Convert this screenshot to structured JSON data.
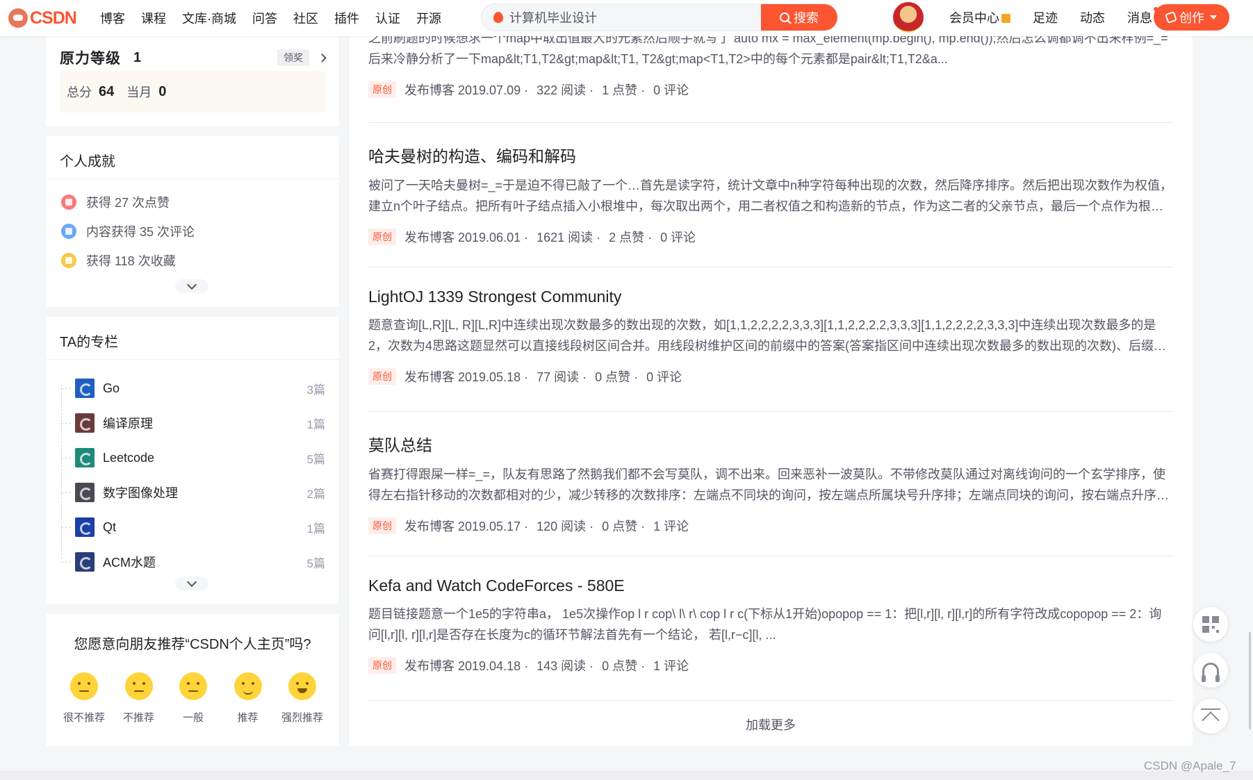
{
  "header": {
    "logo": "CSDN",
    "nav": [
      "博客",
      "课程",
      "文库·商城",
      "问答",
      "社区",
      "插件",
      "认证",
      "开源"
    ],
    "search_value": "计算机毕业设计",
    "search_button": "搜索",
    "right_nav": [
      "会员中心",
      "足迹",
      "动态",
      "消息"
    ],
    "create_button": "创作",
    "accent_color": "#fc5531"
  },
  "level": {
    "name": "原力等级",
    "value": "1",
    "award_button": "领奖",
    "total_label": "总分",
    "total_value": "64",
    "month_label": "当月",
    "month_value": "0"
  },
  "achievements": {
    "title": "个人成就",
    "items": [
      "获得 27 次点赞",
      "内容获得 35 次评论",
      "获得 118 次收藏"
    ]
  },
  "columns": {
    "title": "TA的专栏",
    "items": [
      {
        "name": "Go",
        "count": "3篇",
        "color": "#1f5fbf"
      },
      {
        "name": "编译原理",
        "count": "1篇",
        "color": "#6b3b3b"
      },
      {
        "name": "Leetcode",
        "count": "5篇",
        "color": "#1f8a7a"
      },
      {
        "name": "数字图像处理",
        "count": "2篇",
        "color": "#4a4a55"
      },
      {
        "name": "Qt",
        "count": "1篇",
        "color": "#1a3fa8"
      },
      {
        "name": "ACM水题",
        "count": "5篇",
        "color": "#2a3f7a"
      }
    ]
  },
  "recommend": {
    "title": "您愿意向朋友推荐“CSDN个人主页”吗?",
    "options": [
      "很不推荐",
      "不推荐",
      "一般",
      "推荐",
      "强烈推荐"
    ]
  },
  "articles": [
    {
      "title": "",
      "desc": "之前刷题的时候想求一个map中取出值最大的元素然后顺手就写了 auto mx = max_element(mp.begin(), mp.end());然后怎么调都调不出来样例=_=后来冷静分析了一下map&lt;T1,T2&gt;map&lt;T1, T2&gt;map<T1,T2>中的每个元素都是pair&lt;T1,T2&a...",
      "tag": "原创",
      "date": "发布博客 2019.07.09 ·",
      "reads": "322 阅读 ·",
      "likes": "1 点赞 ·",
      "comments": "0 评论"
    },
    {
      "title": "哈夫曼树的构造、编码和解码",
      "desc": "被问了一天哈夫曼树=_=于是迫不得已敲了一个…首先是读字符，统计文章中n种字符每种出现的次数，然后降序排序。然后把出现次数作为权值，建立n个叶子结点。把所有叶子结点插入小根堆中，每次取出两个，用二者权值之和构造新的节点，作为这二者的父亲节点，最后一个点作为根，记录...",
      "tag": "原创",
      "date": "发布博客 2019.06.01 ·",
      "reads": "1621 阅读 ·",
      "likes": "2 点赞 ·",
      "comments": "0 评论"
    },
    {
      "title": "LightOJ 1339 Strongest Community",
      "desc": "题意查询[L,R][L, R][L,R]中连续出现次数最多的数出现的次数，如[1,1,2,2,2,2,3,3,3][1,1,2,2,2,2,3,3,3][1,1,2,2,2,2,3,3,3]中连续出现次数最多的是2，次数为4思路这题显然可以直接线段树区间合并。用线段树维护区间的前缀中的答案(答案指区间中连续出现次数最多的数出现的次数)、后缀中的答案...",
      "tag": "原创",
      "date": "发布博客 2019.05.18 ·",
      "reads": "77 阅读 ·",
      "likes": "0 点赞 ·",
      "comments": "0 评论"
    },
    {
      "title": "莫队总结",
      "desc": "省赛打得跟屎一样=_=，队友有思路了然鹅我们都不会写莫队，调不出来。回来恶补一波莫队。不带修改莫队通过对离线询问的一个玄学排序，使得左右指针移动的次数都相对的少，减少转移的次数排序：左端点不同块的询问，按左端点所属块号升序排；左端点同块的询问，按右端点升序排奇偶...",
      "tag": "原创",
      "date": "发布博客 2019.05.17 ·",
      "reads": "120 阅读 ·",
      "likes": "0 点赞 ·",
      "comments": "1 评论"
    },
    {
      "title": "Kefa and Watch CodeForces - 580E",
      "desc": "题目链接题意一个1e5的字符串a， 1e5次操作op l r cop\\ l\\ r\\ cop l r c(下标从1开始)opopop == 1：把[l,r][l, r][l,r]的所有字符改成copopop == 2：询问[l,r][l, r][l,r]是否存在长度为c的循环节解法首先有一个结论， 若[l,r−c][l, ...",
      "tag": "原创",
      "date": "发布博客 2019.04.18 ·",
      "reads": "143 阅读 ·",
      "likes": "0 点赞 ·",
      "comments": "1 评论"
    }
  ],
  "load_more": "加载更多",
  "watermark": "CSDN @Apale_7"
}
